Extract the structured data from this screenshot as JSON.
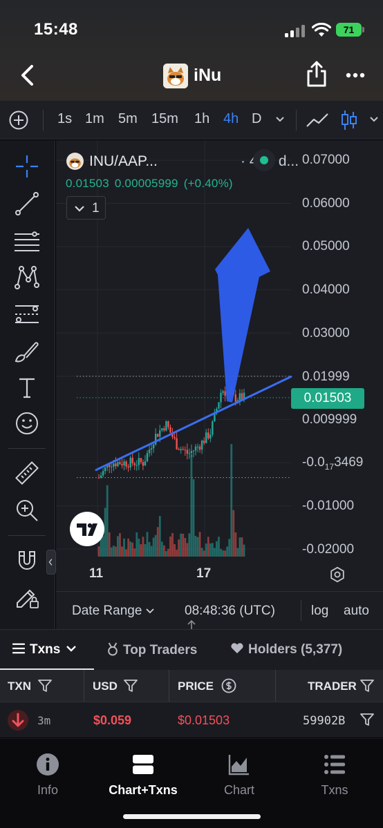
{
  "status_bar": {
    "time": "15:48",
    "battery": "71"
  },
  "header": {
    "title": "iNu"
  },
  "toolbar": {
    "timeframes": [
      "1s",
      "1m",
      "5m",
      "15m",
      "1h",
      "4h",
      "D"
    ],
    "active_timeframe": "4h"
  },
  "chart": {
    "symbol": "INU/AAP...",
    "interval": "· 4h · d...",
    "ohlc": {
      "price": "0.01503",
      "change": "0.00005999",
      "change_pct": "(+0.40%)"
    },
    "series_count": "1",
    "price_axis": [
      "0.07000",
      "0.06000",
      "0.05000",
      "0.04000",
      "0.03000",
      "0.01999",
      "0.009999",
      "-0.01000",
      "-0.02000"
    ],
    "low_label": {
      "prefix": "-0.0",
      "sub": "17",
      "suffix": "3469"
    },
    "current_price": "0.01503",
    "date_labels": [
      "11",
      "17"
    ]
  },
  "chart_data": {
    "type": "candlestick",
    "title": "INU/AAP...",
    "x": [
      "11",
      "17"
    ],
    "ylim": [
      -0.02,
      0.07
    ],
    "last_price": 0.01503,
    "reference_levels": [
      0.01999,
      0.01503,
      -0.003469
    ],
    "series": [
      {
        "name": "INU/AAP...",
        "values": [
          -0.0035,
          0.0,
          0.0,
          0.0,
          0.0,
          0.006,
          0.009,
          0.004,
          0.002,
          0.004,
          0.007,
          0.017,
          0.015,
          0.01503
        ]
      }
    ]
  },
  "range_bar": {
    "date_range": "Date Range",
    "time": "08:48:36 (UTC)",
    "log": "log",
    "auto": "auto"
  },
  "tabs": {
    "txns": "Txns",
    "top_traders": "Top Traders",
    "holders": "Holders (5,377)"
  },
  "table": {
    "headers": {
      "txn": "TXN",
      "usd": "USD",
      "price": "PRICE",
      "trader": "TRADER"
    },
    "rows": [
      {
        "age": "3m",
        "usd": "$0.059",
        "price": "$0.01503",
        "trader": "59902B"
      }
    ]
  },
  "bottom_nav": {
    "info": "Info",
    "chart_txns": "Chart+Txns",
    "chart": "Chart",
    "txns": "Txns"
  },
  "colors": {
    "up": "#26a69a",
    "down": "#ef5350",
    "accent": "#3b82f6",
    "price_tag": "#1fa986"
  }
}
